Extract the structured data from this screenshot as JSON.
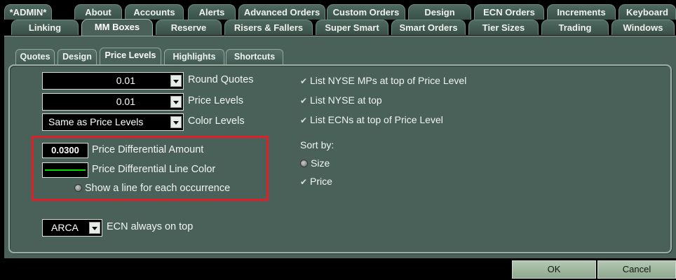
{
  "tabs_row1": [
    "*ADMIN*",
    "About",
    "Accounts",
    "Alerts",
    "Advanced Orders",
    "Custom Orders",
    "Design",
    "ECN Orders",
    "Increments",
    "Keyboard"
  ],
  "tabs_row2": [
    "Linking",
    "MM Boxes",
    "Reserve",
    "Risers & Fallers",
    "Super Smart",
    "Smart Orders",
    "Tier Sizes",
    "Trading",
    "Windows"
  ],
  "active_tab": "MM Boxes",
  "subtabs": [
    "Quotes",
    "Design",
    "Price Levels",
    "Highlights",
    "Shortcuts"
  ],
  "active_subtab": "Price Levels",
  "left_fields": {
    "round_quotes": {
      "value": "0.01",
      "label": "Round Quotes"
    },
    "price_levels": {
      "value": "0.01",
      "label": "Price Levels"
    },
    "color_levels": {
      "value": "Same as Price Levels",
      "label": "Color Levels"
    }
  },
  "price_diff": {
    "amount_value": "0.0300",
    "amount_label": "Price Differential Amount",
    "line_color_label": "Price Differential Line Color",
    "line_color": "#00e000",
    "show_line_label": "Show a line for each occurrence"
  },
  "ecn": {
    "value": "ARCA",
    "label": "ECN always on top"
  },
  "right_options": {
    "list_nyse_mps": "List NYSE MPs at top of Price Level",
    "list_nyse": "List NYSE at top",
    "list_ecns": "List ECNs at top of Price Level",
    "sort_by": "Sort by:",
    "sort_size": "Size",
    "sort_price": "Price"
  },
  "buttons": {
    "ok": "OK",
    "cancel": "Cancel"
  },
  "colors": {
    "panel": "#4a6159",
    "highlight_box": "#e21f26"
  }
}
